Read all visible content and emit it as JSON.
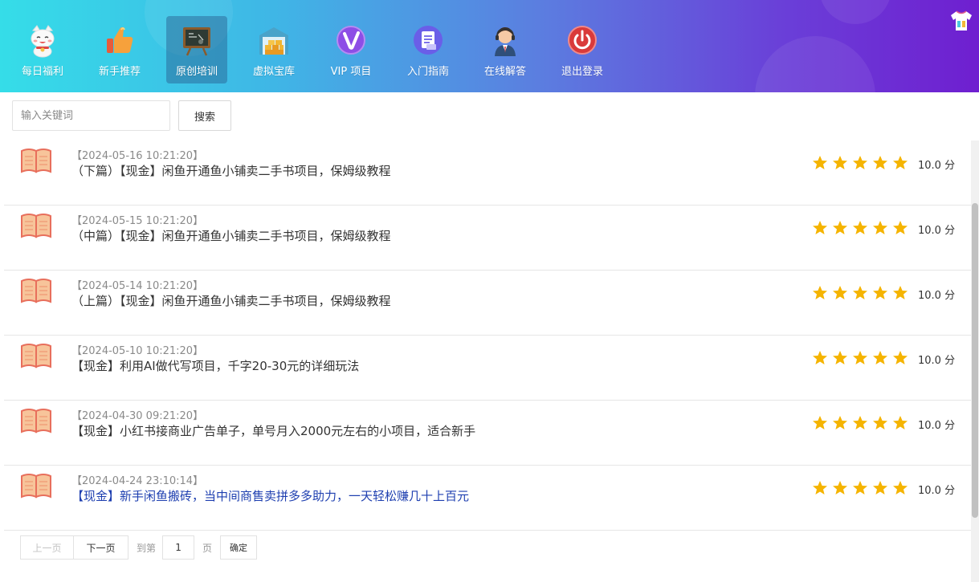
{
  "colors": {
    "star": "#f5b400",
    "title_highlight": "#1e3fb0"
  },
  "nav": [
    {
      "label": "每日福利",
      "icon": "lucky-cat-icon",
      "active": false
    },
    {
      "label": "新手推荐",
      "icon": "thumbs-up-icon",
      "active": false
    },
    {
      "label": "原创培训",
      "icon": "blackboard-icon",
      "active": true
    },
    {
      "label": "虚拟宝库",
      "icon": "warehouse-icon",
      "active": false
    },
    {
      "label": "VIP 项目",
      "icon": "vip-icon",
      "active": false
    },
    {
      "label": "入门指南",
      "icon": "document-icon",
      "active": false
    },
    {
      "label": "在线解答",
      "icon": "support-agent-icon",
      "active": false
    },
    {
      "label": "退出登录",
      "icon": "power-icon",
      "active": false
    }
  ],
  "header": {
    "skin_icon": "shirt-icon"
  },
  "search": {
    "placeholder": "输入关键词",
    "button_label": "搜索"
  },
  "list": [
    {
      "date": "【2024-05-16 10:21:20】",
      "title": "（下篇）【现金】闲鱼开通鱼小铺卖二手书项目，保姆级教程",
      "rating": 5,
      "score": "10.0 分",
      "highlight": false
    },
    {
      "date": "【2024-05-15 10:21:20】",
      "title": "（中篇）【现金】闲鱼开通鱼小铺卖二手书项目，保姆级教程",
      "rating": 5,
      "score": "10.0 分",
      "highlight": false
    },
    {
      "date": "【2024-05-14 10:21:20】",
      "title": "（上篇）【现金】闲鱼开通鱼小铺卖二手书项目，保姆级教程",
      "rating": 5,
      "score": "10.0 分",
      "highlight": false
    },
    {
      "date": "【2024-05-10 10:21:20】",
      "title": "【现金】利用AI做代写项目，千字20-30元的详细玩法",
      "rating": 5,
      "score": "10.0 分",
      "highlight": false
    },
    {
      "date": "【2024-04-30 09:21:20】",
      "title": "【现金】小红书接商业广告单子，单号月入2000元左右的小项目，适合新手",
      "rating": 5,
      "score": "10.0 分",
      "highlight": false
    },
    {
      "date": "【2024-04-24 23:10:14】",
      "title": "【现金】新手闲鱼搬砖，当中间商售卖拼多多助力，一天轻松赚几十上百元",
      "rating": 5,
      "score": "10.0 分",
      "highlight": true
    }
  ],
  "pagination": {
    "prev_label": "上一页",
    "next_label": "下一页",
    "goto_label": "到第",
    "page_value": "1",
    "unit_label": "页",
    "confirm_label": "确定"
  }
}
